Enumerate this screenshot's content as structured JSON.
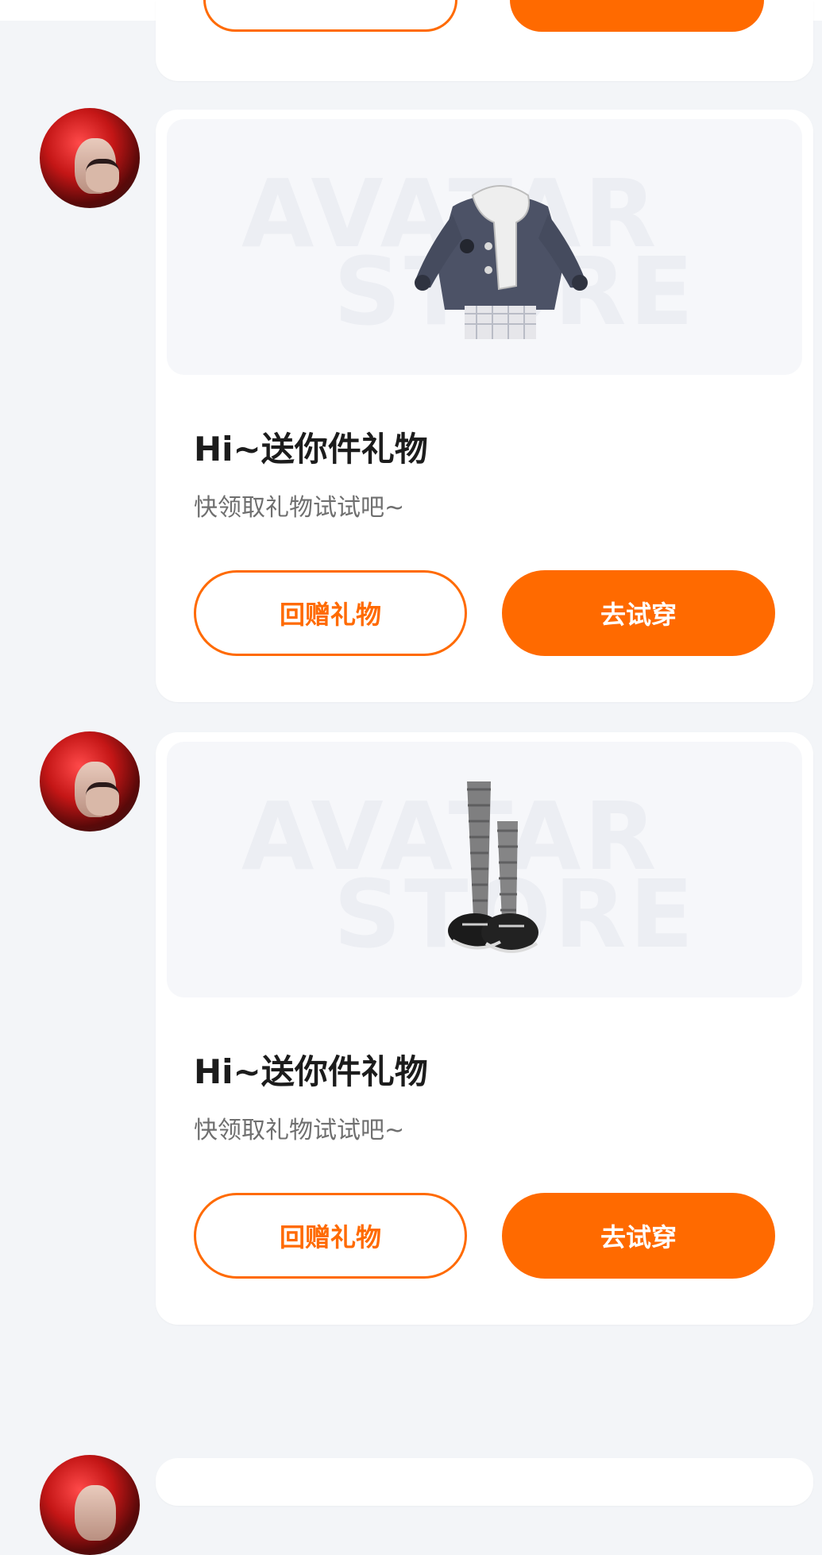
{
  "colors": {
    "accent": "#ff6a00",
    "background": "#f3f5f8",
    "card": "#ffffff"
  },
  "cards": [
    {
      "item": "jacket-icon",
      "watermark_line1": "AVATAR",
      "watermark_line2": "STORE",
      "title": "Hi~送你件礼物",
      "subtitle": "快领取礼物试试吧~",
      "return_gift_label": "回赠礼物",
      "try_on_label": "去试穿"
    },
    {
      "item": "stockings-shoes-icon",
      "watermark_line1": "AVATAR",
      "watermark_line2": "STORE",
      "title": "Hi~送你件礼物",
      "subtitle": "快领取礼物试试吧~",
      "return_gift_label": "回赠礼物",
      "try_on_label": "去试穿"
    }
  ]
}
